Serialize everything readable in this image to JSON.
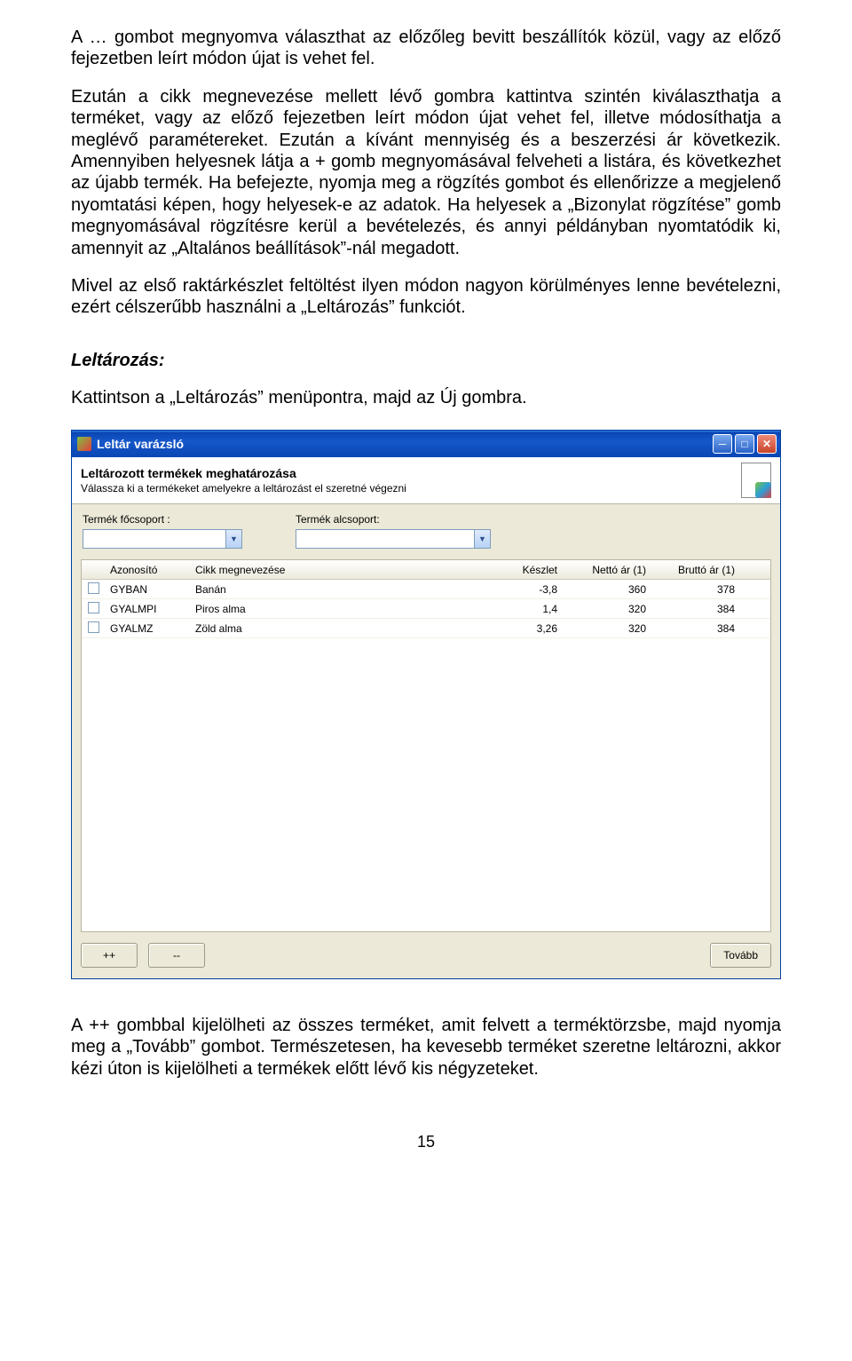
{
  "text": {
    "para1": "A … gombot megnyomva választhat az előzőleg bevitt beszállítók közül, vagy az előző fejezetben leírt módon újat is vehet fel.",
    "para2": "Ezután a cikk megnevezése mellett lévő  gombra kattintva szintén kiválaszthatja a terméket, vagy az előző fejezetben leírt módon újat  vehet fel, illetve módosíthatja a meglévő paramétereket. Ezután a kívánt mennyiség és a beszerzési ár következik. Amennyiben helyesnek látja a + gomb megnyomásával felveheti a listára, és következhet az újabb termék. Ha befejezte, nyomja meg a rögzítés gombot és ellenőrizze a megjelenő nyomtatási képen, hogy helyesek-e az adatok. Ha helyesek a „Bizonylat rögzítése” gomb megnyomásával rögzítésre kerül a bevételezés, és annyi példányban nyomtatódik ki, amennyit az „Altalános beállítások”-nál megadott.",
    "para3": "Mivel az első raktárkészlet feltöltést ilyen módon nagyon körülményes lenne bevételezni, ezért célszerűbb használni a „Leltározás” funkciót.",
    "heading": "Leltározás:",
    "para4": "Kattintson a „Leltározás” menüpontra, majd az Új gombra.",
    "para5": "A ++ gombbal kijelölheti az összes terméket, amit felvett a terméktörzsbe, majd nyomja meg a „Tovább” gombot. Természetesen, ha kevesebb terméket szeretne leltározni, akkor kézi úton is kijelölheti a termékek előtt lévő kis négyzeteket.",
    "pagenum": "15"
  },
  "window": {
    "title": "Leltár varázsló",
    "header_title": "Leltározott termékek meghatározása",
    "header_sub": "Válassza ki a termékeket amelyekre a leltározást el szeretné végezni",
    "group_main_label": "Termék főcsoport :",
    "group_sub_label": "Termék alcsoport:",
    "columns": {
      "id": "Azonosító",
      "name": "Cikk megnevezése",
      "stock": "Készlet",
      "net": "Nettó ár (1)",
      "gross": "Bruttó ár (1)"
    },
    "rows": [
      {
        "id": "GYBAN",
        "name": "Banán",
        "stock": "-3,8",
        "net": "360",
        "gross": "378"
      },
      {
        "id": "GYALMPI",
        "name": "Piros alma",
        "stock": "1,4",
        "net": "320",
        "gross": "384"
      },
      {
        "id": "GYALMZ",
        "name": "Zöld alma",
        "stock": "3,26",
        "net": "320",
        "gross": "384"
      }
    ],
    "btn_plus": "++",
    "btn_minus": "--",
    "btn_next": "Tovább"
  }
}
